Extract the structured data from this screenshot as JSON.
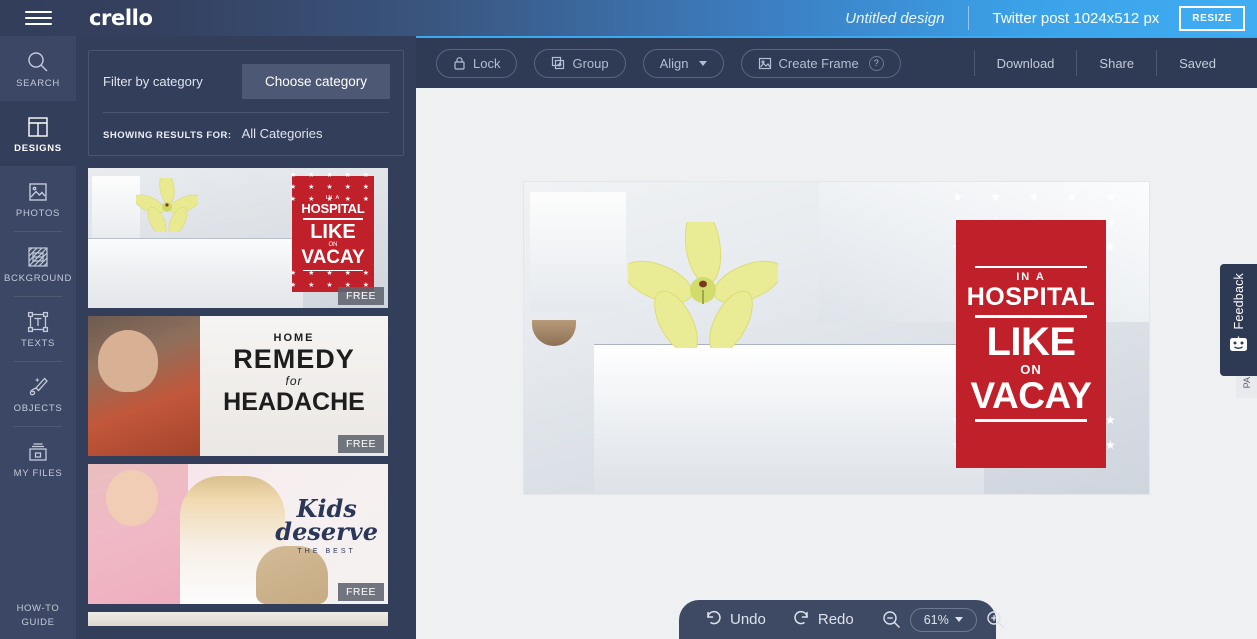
{
  "header": {
    "menu_icon": "hamburger-icon",
    "brand": "crello",
    "doc_title": "Untitled design",
    "canvas_size": "Twitter post 1024x512 px",
    "resize_label": "RESIZE",
    "gradient_from": "#333e5b",
    "gradient_to": "#40adf2"
  },
  "sidebar": {
    "items": [
      {
        "label": "SEARCH",
        "icon": "search-icon",
        "active": false
      },
      {
        "label": "DESIGNS",
        "icon": "designs-icon",
        "active": true
      },
      {
        "label": "PHOTOS",
        "icon": "photos-icon",
        "active": false
      },
      {
        "label": "BCKGROUND",
        "icon": "background-icon",
        "active": false
      },
      {
        "label": "TEXTS",
        "icon": "texts-icon",
        "active": false
      },
      {
        "label": "OBJECTS",
        "icon": "objects-icon",
        "active": false
      },
      {
        "label": "MY FILES",
        "icon": "my-files-icon",
        "active": false
      }
    ],
    "bottom": {
      "line1": "HOW-TO",
      "line2": "GUIDE"
    },
    "bg_color": "#3c4765",
    "active_color": "#333e5a"
  },
  "panel": {
    "filter_label": "Filter by category",
    "choose_button": "Choose category",
    "showing_label": "SHOWING RESULTS FOR:",
    "showing_value": "All Categories",
    "free_badge": "FREE",
    "templates": [
      {
        "name": "hospital-vacay",
        "badge": "FREE",
        "lines": {
          "l1": "IN A",
          "l2": "HOSPITAL",
          "l3": "LIKE",
          "l4": "ON",
          "l5": "VACAY"
        }
      },
      {
        "name": "home-remedy-headache",
        "badge": "FREE",
        "lines": {
          "l1": "HOME",
          "l2": "REMEDY",
          "l3": "for",
          "l4": "HEADACHE"
        }
      },
      {
        "name": "kids-deserve-the-best",
        "badge": "FREE",
        "lines": {
          "l1": "Kids",
          "l2": "deserve",
          "l3": "THE BEST"
        }
      },
      {
        "name": "partial-template",
        "badge": "",
        "lines": {}
      }
    ]
  },
  "toolbar": {
    "lock": "Lock",
    "group": "Group",
    "align": "Align",
    "create_frame": "Create Frame",
    "help": "?",
    "download": "Download",
    "share": "Share",
    "saved": "Saved",
    "bg_color": "#2f3a55"
  },
  "canvas": {
    "design_name": "hospital-vacay",
    "poster_color": "#c0202a",
    "lines": {
      "l1": "IN A",
      "l2": "HOSPITAL",
      "l3": "LIKE",
      "l4": "ON",
      "l5": "VACAY"
    },
    "star": "★"
  },
  "bottombar": {
    "undo": "Undo",
    "redo": "Redo",
    "zoom_value": "61%",
    "zoom_out_icon": "zoom-out-icon",
    "zoom_in_icon": "zoom-in-icon"
  },
  "feedback": {
    "label": "Feedback",
    "icon": "robot-face-icon",
    "second_tab": "PA"
  }
}
